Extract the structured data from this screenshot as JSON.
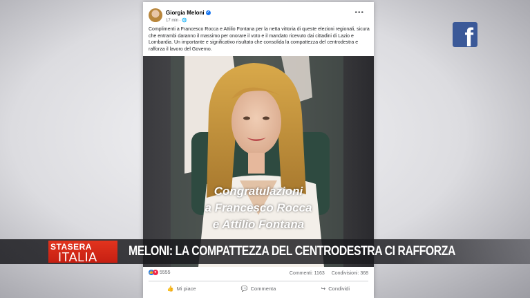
{
  "post": {
    "author": "Giorgia Meloni",
    "time": "17 min · 🌐",
    "more_label": "•••",
    "caption": "Complimenti a Francesco Rocca e Attilio Fontana per la netta vittoria di queste elezioni regionali, sicura che entrambi daranno il massimo per onorare il voto e il mandato ricevuto dai cittadini di Lazio e Lombardia. Un importante e significativo risultato che consolida la compattezza del centrodestra e rafforza il lavoro del Governo.",
    "image_text": {
      "line1": "Congratulazioni",
      "line2": "a Francesco Rocca",
      "line3": "e Attilio Fontana"
    },
    "reactions_count": "5555",
    "comments": "Commenti: 1163",
    "shares": "Condivisioni: 368",
    "actions": {
      "like": "Mi piace",
      "comment": "Commenta",
      "share": "Condividi"
    }
  },
  "brand": {
    "logo_glyph": "f",
    "icon": "facebook-icon"
  },
  "banner": {
    "show_line1": "STASERA",
    "show_line2": "ITALIA",
    "headline": "MELONI: LA COMPATTEZZA DEL CENTRODESTRA CI RAFFORZA"
  },
  "colors": {
    "facebook_blue": "#3b5998",
    "verified_blue": "#1877f2",
    "show_red": "#d22a18"
  }
}
